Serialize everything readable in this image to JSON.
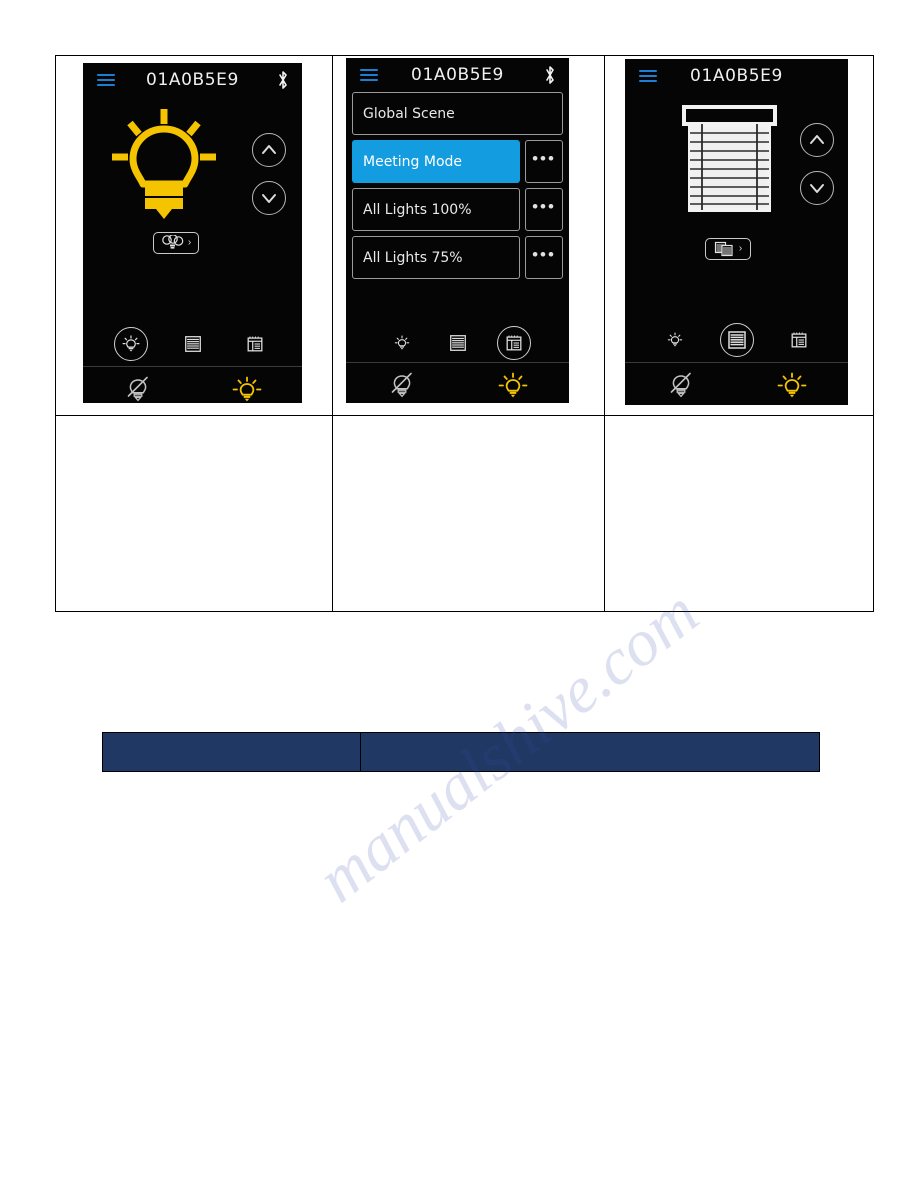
{
  "page": {
    "background_color": "#ffffff",
    "watermark_text": "manualshive.com"
  },
  "colors": {
    "screen_background": "#050505",
    "accent_blue": "#139ce0",
    "menu_blue": "#1d7fd4",
    "bulb_yellow": "#f5c400",
    "outline_grey": "#c9c9c9",
    "navy_fill": "#1f3864",
    "table_border": "#000000"
  },
  "screens": [
    {
      "id": "lighting-screen",
      "titlebar": {
        "menu_icon": "hamburger-icon",
        "title": "01A0B5E9",
        "status_icon": "bluetooth-icon"
      },
      "main": {
        "primary_icon": "light-bulb-on-icon",
        "up_button": "chevron-up-icon",
        "down_button": "chevron-down-icon",
        "group_button": {
          "icon": "bulb-group-icon",
          "chevron": "›"
        }
      },
      "tabs": [
        {
          "name": "tab-lights",
          "icon": "light-bulb-icon",
          "active": true
        },
        {
          "name": "tab-blinds",
          "icon": "blinds-icon",
          "active": false
        },
        {
          "name": "tab-scenes",
          "icon": "scenes-icon",
          "active": false
        }
      ],
      "bottom_bar": [
        {
          "name": "all-off-button",
          "icon": "bulb-off-icon",
          "state": "off"
        },
        {
          "name": "all-on-button",
          "icon": "bulb-on-icon",
          "state": "on"
        }
      ]
    },
    {
      "id": "scenes-screen",
      "titlebar": {
        "menu_icon": "hamburger-icon",
        "title": "01A0B5E9",
        "status_icon": "bluetooth-icon"
      },
      "scene_list": [
        {
          "label": "Global Scene",
          "selected": false,
          "has_more": false,
          "more_label": "•••"
        },
        {
          "label": "Meeting Mode",
          "selected": true,
          "has_more": true,
          "more_label": "•••"
        },
        {
          "label": "All Lights 100%",
          "selected": false,
          "has_more": true,
          "more_label": "•••"
        },
        {
          "label": "All Lights 75%",
          "selected": false,
          "has_more": true,
          "more_label": "•••"
        }
      ],
      "tabs": [
        {
          "name": "tab-lights",
          "icon": "light-bulb-icon",
          "active": false
        },
        {
          "name": "tab-blinds",
          "icon": "blinds-icon",
          "active": false
        },
        {
          "name": "tab-scenes",
          "icon": "scenes-icon",
          "active": true
        }
      ],
      "bottom_bar": [
        {
          "name": "all-off-button",
          "icon": "bulb-off-icon",
          "state": "off"
        },
        {
          "name": "all-on-button",
          "icon": "bulb-on-icon",
          "state": "on"
        }
      ]
    },
    {
      "id": "blinds-screen",
      "titlebar": {
        "menu_icon": "hamburger-icon",
        "title": "01A0B5E9",
        "status_icon": "none"
      },
      "main": {
        "primary_icon": "window-blind-icon",
        "up_button": "chevron-up-icon",
        "down_button": "chevron-down-icon",
        "group_button": {
          "icon": "blind-group-icon",
          "chevron": "›"
        }
      },
      "tabs": [
        {
          "name": "tab-lights",
          "icon": "light-bulb-icon",
          "active": false
        },
        {
          "name": "tab-blinds",
          "icon": "blinds-icon",
          "active": true
        },
        {
          "name": "tab-scenes",
          "icon": "scenes-icon",
          "active": false
        }
      ],
      "bottom_bar": [
        {
          "name": "all-off-button",
          "icon": "bulb-off-icon",
          "state": "off"
        },
        {
          "name": "all-on-button",
          "icon": "bulb-on-icon",
          "state": "on"
        }
      ]
    }
  ],
  "caption_table": {
    "columns": 3,
    "rows": [
      {
        "cells": [
          "",
          "",
          ""
        ]
      }
    ]
  },
  "navy_table": {
    "cells": [
      "",
      ""
    ]
  }
}
